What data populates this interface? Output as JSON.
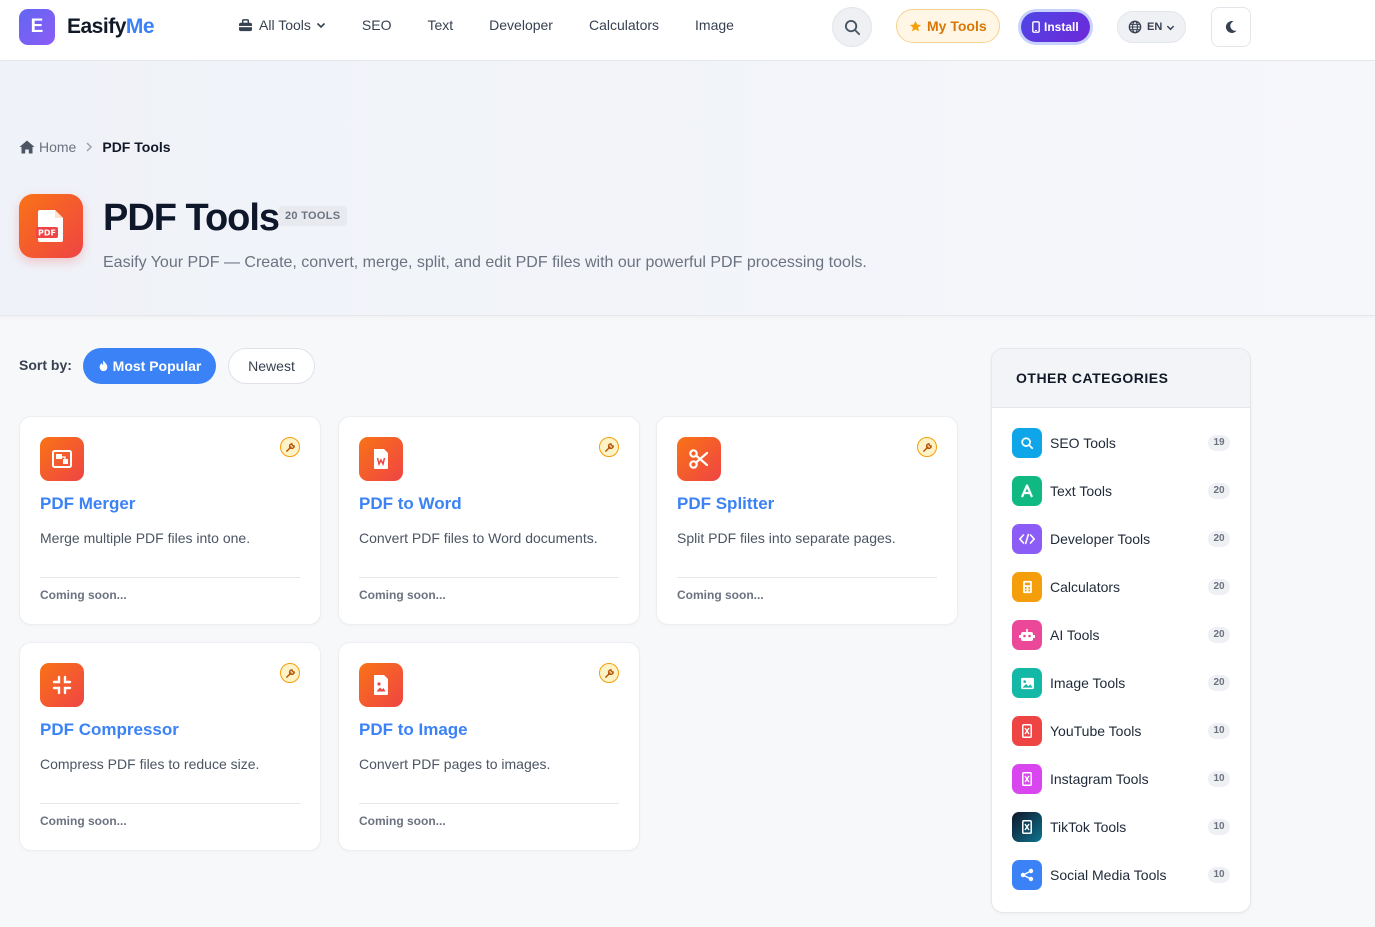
{
  "header": {
    "logo_letter": "E",
    "logo_name": "Easify",
    "logo_name_accent": "Me",
    "nav": [
      {
        "label": "All Tools"
      },
      {
        "label": "SEO"
      },
      {
        "label": "Text"
      },
      {
        "label": "Developer"
      },
      {
        "label": "Calculators"
      },
      {
        "label": "Image"
      }
    ],
    "my_tools_label": "My Tools",
    "install_label": "Install",
    "language": "EN"
  },
  "breadcrumb": {
    "home": "Home",
    "current": "PDF Tools"
  },
  "hero": {
    "icon_label": "PDF",
    "title": "PDF Tools",
    "count_badge": "20 TOOLS",
    "description": "Easify Your PDF — Create, convert, merge, split, and edit PDF files with our powerful PDF processing tools."
  },
  "sort": {
    "label": "Sort by:",
    "options": [
      "Most Popular",
      "Newest"
    ],
    "active": "Most Popular"
  },
  "tools": [
    {
      "title": "PDF Merger",
      "description": "Merge multiple PDF files into one.",
      "status": "Coming soon...",
      "icon": "merge-icon"
    },
    {
      "title": "PDF to Word",
      "description": "Convert PDF files to Word documents.",
      "status": "Coming soon...",
      "icon": "word-doc-icon"
    },
    {
      "title": "PDF Splitter",
      "description": "Split PDF files into separate pages.",
      "status": "Coming soon...",
      "icon": "scissors-icon"
    },
    {
      "title": "PDF Compressor",
      "description": "Compress PDF files to reduce size.",
      "status": "Coming soon...",
      "icon": "compress-icon"
    },
    {
      "title": "PDF to Image",
      "description": "Convert PDF pages to images.",
      "status": "Coming soon...",
      "icon": "image-file-icon"
    }
  ],
  "sidebar": {
    "title": "OTHER CATEGORIES",
    "categories": [
      {
        "label": "SEO Tools",
        "count": "19",
        "color": "#0ea5e9",
        "icon": "search-icon"
      },
      {
        "label": "Text Tools",
        "count": "20",
        "color": "#10b981",
        "icon": "letter-a-icon"
      },
      {
        "label": "Developer Tools",
        "count": "20",
        "color": "#8b5cf6",
        "icon": "code-icon"
      },
      {
        "label": "Calculators",
        "count": "20",
        "color": "#f59e0b",
        "icon": "calculator-icon"
      },
      {
        "label": "AI Tools",
        "count": "20",
        "color": "#ec4899",
        "icon": "robot-icon"
      },
      {
        "label": "Image Tools",
        "count": "20",
        "color": "#14b8a6",
        "icon": "image-icon"
      },
      {
        "label": "YouTube Tools",
        "count": "10",
        "color": "#ef4444",
        "icon": "youtube-icon"
      },
      {
        "label": "Instagram Tools",
        "count": "10",
        "color": "#d946ef",
        "icon": "instagram-icon"
      },
      {
        "label": "TikTok Tools",
        "count": "10",
        "color": "#0f172a",
        "icon": "tiktok-icon"
      },
      {
        "label": "Social Media Tools",
        "count": "10",
        "color": "#3b82f6",
        "icon": "share-icon"
      }
    ]
  }
}
